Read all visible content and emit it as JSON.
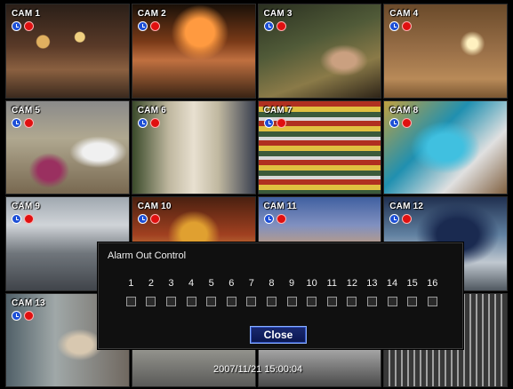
{
  "cameras": [
    {
      "label": "CAM 1"
    },
    {
      "label": "CAM 2"
    },
    {
      "label": "CAM 3"
    },
    {
      "label": "CAM 4"
    },
    {
      "label": "CAM 5"
    },
    {
      "label": "CAM 6"
    },
    {
      "label": "CAM 7"
    },
    {
      "label": "CAM 8"
    },
    {
      "label": "CAM 9"
    },
    {
      "label": "CAM 10"
    },
    {
      "label": "CAM 11"
    },
    {
      "label": "CAM 12"
    },
    {
      "label": "CAM 13"
    },
    {
      "label": ""
    },
    {
      "label": ""
    },
    {
      "label": ""
    }
  ],
  "tile_icons": {
    "clock": "clock-icon",
    "record": "record-icon"
  },
  "alarm_dialog": {
    "title": "Alarm Out Control",
    "outputs": [
      "1",
      "2",
      "3",
      "4",
      "5",
      "6",
      "7",
      "8",
      "9",
      "10",
      "11",
      "12",
      "13",
      "14",
      "15",
      "16"
    ],
    "close_label": "Close"
  },
  "timestamp": "2007/11/21 15:00:04",
  "colors": {
    "record": "#e01010",
    "clock": "#1d4fd6",
    "close_button": "#0a1650",
    "dialog_bg": "#101010"
  }
}
